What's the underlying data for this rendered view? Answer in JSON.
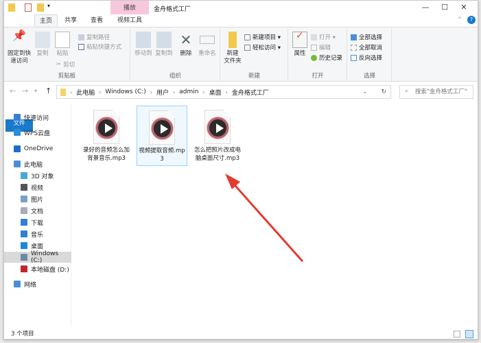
{
  "window": {
    "title": "金舟格式工厂",
    "context_tab": "播放",
    "controls": {
      "minimize": "—",
      "maximize": "☐",
      "close": "✕"
    }
  },
  "tabs": [
    "文件",
    "主页",
    "共享",
    "查看",
    "视频工具"
  ],
  "ribbon": {
    "clipboard": {
      "label": "剪贴板",
      "pin": "固定到快速访问",
      "copy": "复制",
      "paste": "粘贴",
      "copy_path": "复制路径",
      "paste_shortcut": "粘贴快捷方式",
      "cut": "剪切"
    },
    "organize": {
      "label": "组织",
      "move_to": "移动到",
      "copy_to": "复制到",
      "delete": "删除",
      "rename": "重命名"
    },
    "new": {
      "label": "新建",
      "new_folder": "新建\n文件夹",
      "new_item": "新建项目 ▾",
      "easy_access": "轻松访问 ▾"
    },
    "open": {
      "label": "打开",
      "properties": "属性",
      "open": "打开 ▾",
      "edit": "编辑",
      "history": "历史记录"
    },
    "select": {
      "label": "选择",
      "select_all": "全部选择",
      "select_none": "全部取消",
      "invert": "反向选择"
    }
  },
  "address": {
    "crumbs": [
      "此电脑",
      "Windows (C:)",
      "用户",
      "admin",
      "桌面",
      "金舟格式工厂"
    ],
    "search_placeholder": "搜索\"金舟格式工厂\""
  },
  "nav": [
    {
      "label": "快速访问",
      "color": "#3a7fd5"
    },
    {
      "label": "WPS云盘",
      "color": "#2a8fd8"
    },
    {
      "label": "OneDrive",
      "color": "#1d6fc9"
    },
    {
      "label": "此电脑",
      "color": "#4a8fd6"
    },
    {
      "label": "3D 对象",
      "color": "#49a9d9"
    },
    {
      "label": "视频",
      "color": "#555"
    },
    {
      "label": "图片",
      "color": "#7aa0c8"
    },
    {
      "label": "文档",
      "color": "#aab"
    },
    {
      "label": "下载",
      "color": "#2f7fd6"
    },
    {
      "label": "音乐",
      "color": "#2f7fd6"
    },
    {
      "label": "桌面",
      "color": "#1e88d8"
    },
    {
      "label": "Windows (C:)",
      "color": "#6b8aa8"
    },
    {
      "label": "本地磁盘 (D:)",
      "color": "#c0262c"
    },
    {
      "label": "网络",
      "color": "#4a8fd6"
    }
  ],
  "files": [
    {
      "name": "录好的音频怎么加背景音乐.mp3"
    },
    {
      "name": "视频提取音频.mp3"
    },
    {
      "name": "怎么把照片改成电脑桌面尺寸.mp3"
    }
  ],
  "status": {
    "count": "3 个项目"
  },
  "colors": {
    "accent": "#1979ca",
    "context_tab": "#f7c7dc",
    "arrow": "#e53a2f"
  }
}
